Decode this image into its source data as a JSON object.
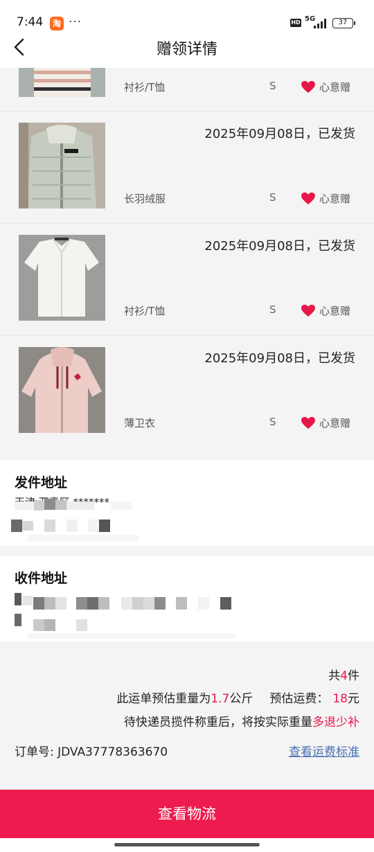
{
  "status_bar": {
    "time": "7:44",
    "app_icon_char": "淘",
    "dots": "···",
    "hd": "HD",
    "network": "5G",
    "battery": "37"
  },
  "header": {
    "title": "赠领详情",
    "back_icon": "chevron-left-icon"
  },
  "items": [
    {
      "date_status": "",
      "category": "衬衫/T恤",
      "size": "S",
      "gift_label": "心意赠"
    },
    {
      "date_status": "2025年09月08日，已发货",
      "category": "长羽绒服",
      "size": "S",
      "gift_label": "心意赠"
    },
    {
      "date_status": "2025年09月08日，已发货",
      "category": "衬衫/T恤",
      "size": "S",
      "gift_label": "心意赠"
    },
    {
      "date_status": "2025年09月08日，已发货",
      "category": "薄卫衣",
      "size": "S",
      "gift_label": "心意赠"
    }
  ],
  "sender": {
    "title": "发件地址",
    "line1": "天津 西青区 *******"
  },
  "receiver": {
    "title": "收件地址"
  },
  "summary": {
    "total_prefix": "共",
    "total_count": "4",
    "total_suffix": "件",
    "weight_prefix": "此运单预估重量为",
    "weight_value": "1.7",
    "weight_unit": "公斤",
    "fee_label": "预估运费：",
    "fee_value": "18",
    "fee_unit": "元",
    "note_prefix": "待快递员揽件称重后，将按实际重量",
    "note_highlight": "多退少补",
    "order_label": "订单号: JDVA37778363670",
    "fee_standard_link": "查看运费标准"
  },
  "cta_label": "查看物流",
  "colors": {
    "accent": "#ee1c4e",
    "highlight_red": "#e8174a",
    "link_blue": "#4a6fb3"
  }
}
